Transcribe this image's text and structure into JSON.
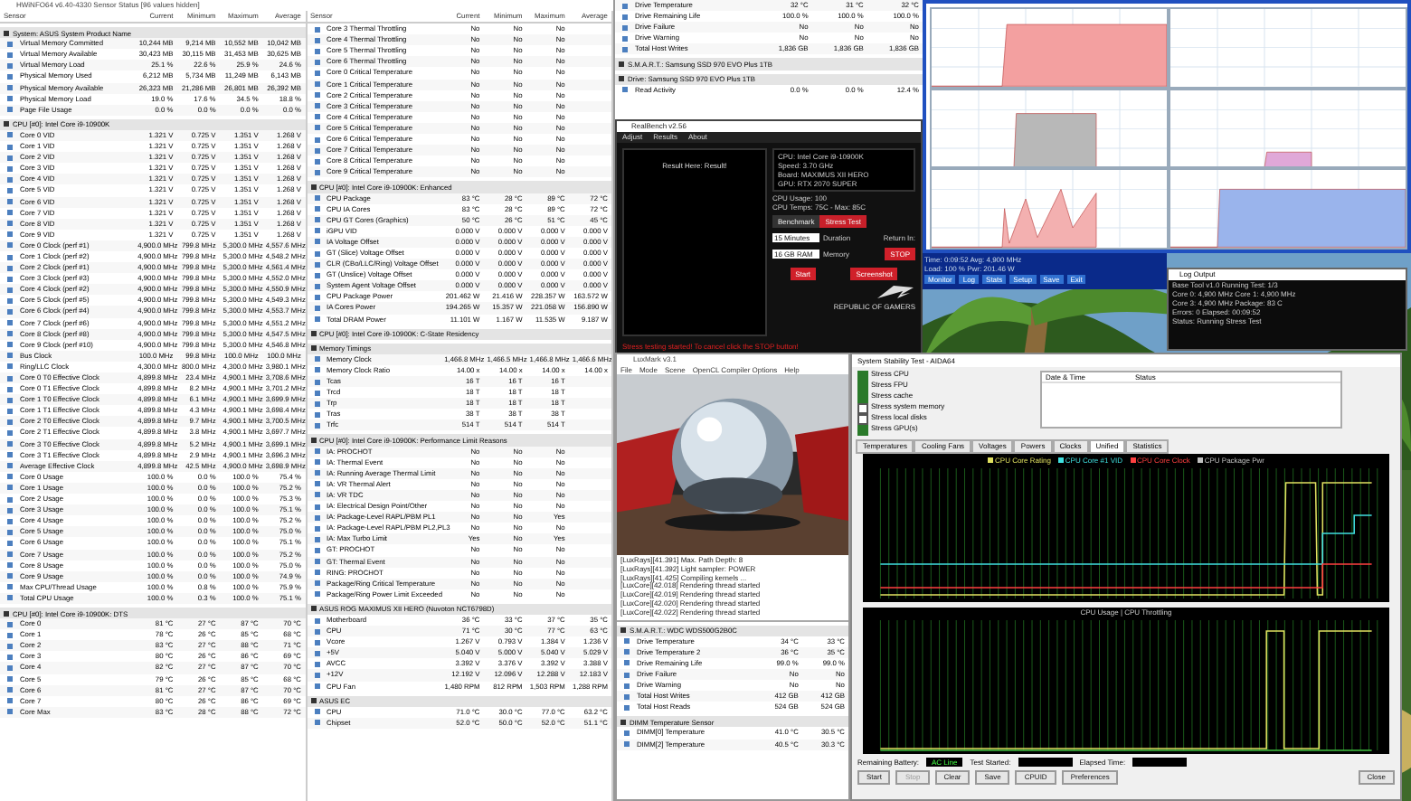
{
  "hwinfo": {
    "title": "HWiNFO64 v6.40-4330 Sensor Status [96 values hidden]",
    "panes": [
      {
        "columns": [
          "Sensor",
          "Current",
          "Minimum",
          "Maximum",
          "Average"
        ],
        "sections": [
          {
            "title": "System: ASUS System Product Name",
            "rows": [
              [
                "Virtual Memory Committed",
                "10,244 MB",
                "9,214 MB",
                "10,552 MB",
                "10,042 MB"
              ],
              [
                "Virtual Memory Available",
                "30,423 MB",
                "30,115 MB",
                "31,453 MB",
                "30,625 MB"
              ],
              [
                "Virtual Memory Load",
                "25.1 %",
                "22.6 %",
                "25.9 %",
                "24.6 %"
              ],
              [
                "Physical Memory Used",
                "6,212 MB",
                "5,734 MB",
                "11,249 MB",
                "6,143 MB"
              ],
              [
                "Physical Memory Available",
                "26,323 MB",
                "21,286 MB",
                "26,801 MB",
                "26,392 MB"
              ],
              [
                "Physical Memory Load",
                "19.0 %",
                "17.6 %",
                "34.5 %",
                "18.8 %"
              ],
              [
                "Page File Usage",
                "0.0 %",
                "0.0 %",
                "0.0 %",
                "0.0 %"
              ]
            ]
          },
          {
            "title": "CPU [#0]: Intel Core i9-10900K",
            "rows": [
              [
                "Core 0 VID",
                "1.321 V",
                "0.725 V",
                "1.351 V",
                "1.268 V"
              ],
              [
                "Core 1 VID",
                "1.321 V",
                "0.725 V",
                "1.351 V",
                "1.268 V"
              ],
              [
                "Core 2 VID",
                "1.321 V",
                "0.725 V",
                "1.351 V",
                "1.268 V"
              ],
              [
                "Core 3 VID",
                "1.321 V",
                "0.725 V",
                "1.351 V",
                "1.268 V"
              ],
              [
                "Core 4 VID",
                "1.321 V",
                "0.725 V",
                "1.351 V",
                "1.268 V"
              ],
              [
                "Core 5 VID",
                "1.321 V",
                "0.725 V",
                "1.351 V",
                "1.268 V"
              ],
              [
                "Core 6 VID",
                "1.321 V",
                "0.725 V",
                "1.351 V",
                "1.268 V"
              ],
              [
                "Core 7 VID",
                "1.321 V",
                "0.725 V",
                "1.351 V",
                "1.268 V"
              ],
              [
                "Core 8 VID",
                "1.321 V",
                "0.725 V",
                "1.351 V",
                "1.268 V"
              ],
              [
                "Core 9 VID",
                "1.321 V",
                "0.725 V",
                "1.351 V",
                "1.268 V"
              ],
              [
                "Core 0 Clock (perf #1)",
                "4,900.0 MHz",
                "799.8 MHz",
                "5,300.0 MHz",
                "4,557.6 MHz"
              ],
              [
                "Core 1 Clock (perf #2)",
                "4,900.0 MHz",
                "799.8 MHz",
                "5,300.0 MHz",
                "4,548.2 MHz"
              ],
              [
                "Core 2 Clock (perf #1)",
                "4,900.0 MHz",
                "799.8 MHz",
                "5,300.0 MHz",
                "4,561.4 MHz"
              ],
              [
                "Core 3 Clock (perf #3)",
                "4,900.0 MHz",
                "799.8 MHz",
                "5,300.0 MHz",
                "4,552.0 MHz"
              ],
              [
                "Core 4 Clock (perf #2)",
                "4,900.0 MHz",
                "799.8 MHz",
                "5,300.0 MHz",
                "4,550.9 MHz"
              ],
              [
                "Core 5 Clock (perf #5)",
                "4,900.0 MHz",
                "799.8 MHz",
                "5,300.0 MHz",
                "4,549.3 MHz"
              ],
              [
                "Core 6 Clock (perf #4)",
                "4,900.0 MHz",
                "799.8 MHz",
                "5,300.0 MHz",
                "4,553.7 MHz"
              ],
              [
                "Core 7 Clock (perf #6)",
                "4,900.0 MHz",
                "799.8 MHz",
                "5,300.0 MHz",
                "4,551.2 MHz"
              ],
              [
                "Core 8 Clock (perf #8)",
                "4,900.0 MHz",
                "799.8 MHz",
                "5,300.0 MHz",
                "4,547.5 MHz"
              ],
              [
                "Core 9 Clock (perf #10)",
                "4,900.0 MHz",
                "799.8 MHz",
                "5,300.0 MHz",
                "4,546.8 MHz"
              ],
              [
                "Bus Clock",
                "100.0 MHz",
                "99.8 MHz",
                "100.0 MHz",
                "100.0 MHz"
              ],
              [
                "Ring/LLC Clock",
                "4,300.0 MHz",
                "800.0 MHz",
                "4,300.0 MHz",
                "3,980.1 MHz"
              ],
              [
                "Core 0 T0 Effective Clock",
                "4,899.8 MHz",
                "23.4 MHz",
                "4,900.1 MHz",
                "3,708.6 MHz"
              ],
              [
                "Core 0 T1 Effective Clock",
                "4,899.8 MHz",
                "8.2 MHz",
                "4,900.1 MHz",
                "3,701.2 MHz"
              ],
              [
                "Core 1 T0 Effective Clock",
                "4,899.8 MHz",
                "6.1 MHz",
                "4,900.1 MHz",
                "3,699.9 MHz"
              ],
              [
                "Core 1 T1 Effective Clock",
                "4,899.8 MHz",
                "4.3 MHz",
                "4,900.1 MHz",
                "3,698.4 MHz"
              ],
              [
                "Core 2 T0 Effective Clock",
                "4,899.8 MHz",
                "9.7 MHz",
                "4,900.1 MHz",
                "3,700.5 MHz"
              ],
              [
                "Core 2 T1 Effective Clock",
                "4,899.8 MHz",
                "3.8 MHz",
                "4,900.1 MHz",
                "3,697.7 MHz"
              ],
              [
                "Core 3 T0 Effective Clock",
                "4,899.8 MHz",
                "5.2 MHz",
                "4,900.1 MHz",
                "3,699.1 MHz"
              ],
              [
                "Core 3 T1 Effective Clock",
                "4,899.8 MHz",
                "2.9 MHz",
                "4,900.1 MHz",
                "3,696.3 MHz"
              ],
              [
                "Average Effective Clock",
                "4,899.8 MHz",
                "42.5 MHz",
                "4,900.0 MHz",
                "3,698.9 MHz"
              ],
              [
                "Core 0 Usage",
                "100.0 %",
                "0.0 %",
                "100.0 %",
                "75.4 %"
              ],
              [
                "Core 1 Usage",
                "100.0 %",
                "0.0 %",
                "100.0 %",
                "75.2 %"
              ],
              [
                "Core 2 Usage",
                "100.0 %",
                "0.0 %",
                "100.0 %",
                "75.3 %"
              ],
              [
                "Core 3 Usage",
                "100.0 %",
                "0.0 %",
                "100.0 %",
                "75.1 %"
              ],
              [
                "Core 4 Usage",
                "100.0 %",
                "0.0 %",
                "100.0 %",
                "75.2 %"
              ],
              [
                "Core 5 Usage",
                "100.0 %",
                "0.0 %",
                "100.0 %",
                "75.0 %"
              ],
              [
                "Core 6 Usage",
                "100.0 %",
                "0.0 %",
                "100.0 %",
                "75.1 %"
              ],
              [
                "Core 7 Usage",
                "100.0 %",
                "0.0 %",
                "100.0 %",
                "75.2 %"
              ],
              [
                "Core 8 Usage",
                "100.0 %",
                "0.0 %",
                "100.0 %",
                "75.0 %"
              ],
              [
                "Core 9 Usage",
                "100.0 %",
                "0.0 %",
                "100.0 %",
                "74.9 %"
              ],
              [
                "Max CPU/Thread Usage",
                "100.0 %",
                "0.8 %",
                "100.0 %",
                "75.9 %"
              ],
              [
                "Total CPU Usage",
                "100.0 %",
                "0.3 %",
                "100.0 %",
                "75.1 %"
              ]
            ]
          },
          {
            "title": "CPU [#0]: Intel Core i9-10900K: DTS",
            "rows": [
              [
                "Core 0",
                "81 °C",
                "27 °C",
                "87 °C",
                "70 °C"
              ],
              [
                "Core 1",
                "78 °C",
                "26 °C",
                "85 °C",
                "68 °C"
              ],
              [
                "Core 2",
                "83 °C",
                "27 °C",
                "88 °C",
                "71 °C"
              ],
              [
                "Core 3",
                "80 °C",
                "26 °C",
                "86 °C",
                "69 °C"
              ],
              [
                "Core 4",
                "82 °C",
                "27 °C",
                "87 °C",
                "70 °C"
              ],
              [
                "Core 5",
                "79 °C",
                "26 °C",
                "85 °C",
                "68 °C"
              ],
              [
                "Core 6",
                "81 °C",
                "27 °C",
                "87 °C",
                "70 °C"
              ],
              [
                "Core 7",
                "80 °C",
                "26 °C",
                "86 °C",
                "69 °C"
              ],
              [
                "Core Max",
                "83 °C",
                "28 °C",
                "88 °C",
                "72 °C"
              ]
            ]
          }
        ]
      },
      {
        "columns": [
          "Sensor",
          "Current",
          "Minimum",
          "Maximum",
          "Average"
        ],
        "sections": [
          {
            "rows": [
              [
                "Core 3 Thermal Throttling",
                "No",
                "No",
                "No",
                ""
              ],
              [
                "Core 4 Thermal Throttling",
                "No",
                "No",
                "No",
                ""
              ],
              [
                "Core 5 Thermal Throttling",
                "No",
                "No",
                "No",
                ""
              ],
              [
                "Core 6 Thermal Throttling",
                "No",
                "No",
                "No",
                ""
              ],
              [
                "Core 0 Critical Temperature",
                "No",
                "No",
                "No",
                ""
              ],
              [
                "Core 1 Critical Temperature",
                "No",
                "No",
                "No",
                ""
              ],
              [
                "Core 2 Critical Temperature",
                "No",
                "No",
                "No",
                ""
              ],
              [
                "Core 3 Critical Temperature",
                "No",
                "No",
                "No",
                ""
              ],
              [
                "Core 4 Critical Temperature",
                "No",
                "No",
                "No",
                ""
              ],
              [
                "Core 5 Critical Temperature",
                "No",
                "No",
                "No",
                ""
              ],
              [
                "Core 6 Critical Temperature",
                "No",
                "No",
                "No",
                ""
              ],
              [
                "Core 7 Critical Temperature",
                "No",
                "No",
                "No",
                ""
              ],
              [
                "Core 8 Critical Temperature",
                "No",
                "No",
                "No",
                ""
              ],
              [
                "Core 9 Critical Temperature",
                "No",
                "No",
                "No",
                ""
              ]
            ]
          },
          {
            "title": "CPU [#0]: Intel Core i9-10900K: Enhanced",
            "rows": [
              [
                "CPU Package",
                "83 °C",
                "28 °C",
                "89 °C",
                "72 °C"
              ],
              [
                "CPU IA Cores",
                "83 °C",
                "28 °C",
                "89 °C",
                "72 °C"
              ],
              [
                "CPU GT Cores (Graphics)",
                "50 °C",
                "26 °C",
                "51 °C",
                "45 °C"
              ],
              [
                "iGPU VID",
                "0.000 V",
                "0.000 V",
                "0.000 V",
                "0.000 V"
              ],
              [
                "IA Voltage Offset",
                "0.000 V",
                "0.000 V",
                "0.000 V",
                "0.000 V"
              ],
              [
                "GT (Slice) Voltage Offset",
                "0.000 V",
                "0.000 V",
                "0.000 V",
                "0.000 V"
              ],
              [
                "CLR (CBo/LLC/Ring) Voltage Offset",
                "0.000 V",
                "0.000 V",
                "0.000 V",
                "0.000 V"
              ],
              [
                "GT (Unslice) Voltage Offset",
                "0.000 V",
                "0.000 V",
                "0.000 V",
                "0.000 V"
              ],
              [
                "System Agent Voltage Offset",
                "0.000 V",
                "0.000 V",
                "0.000 V",
                "0.000 V"
              ],
              [
                "CPU Package Power",
                "201.462 W",
                "21.416 W",
                "228.357 W",
                "163.572 W"
              ],
              [
                "IA Cores Power",
                "194.265 W",
                "15.357 W",
                "221.058 W",
                "156.890 W"
              ],
              [
                "Total DRAM Power",
                "11.101 W",
                "1.167 W",
                "11.535 W",
                "9.187 W"
              ]
            ]
          },
          {
            "title": "CPU [#0]: Intel Core i9-10900K: C-State Residency"
          },
          {
            "title": "Memory Timings",
            "rows": [
              [
                "Memory Clock",
                "1,466.8 MHz",
                "1,466.5 MHz",
                "1,466.8 MHz",
                "1,466.6 MHz"
              ],
              [
                "Memory Clock Ratio",
                "14.00 x",
                "14.00 x",
                "14.00 x",
                "14.00 x"
              ],
              [
                "Tcas",
                "16 T",
                "16 T",
                "16 T",
                ""
              ],
              [
                "Trcd",
                "18 T",
                "18 T",
                "18 T",
                ""
              ],
              [
                "Trp",
                "18 T",
                "18 T",
                "18 T",
                ""
              ],
              [
                "Tras",
                "38 T",
                "38 T",
                "38 T",
                ""
              ],
              [
                "Trfc",
                "514 T",
                "514 T",
                "514 T",
                ""
              ]
            ]
          },
          {
            "title": "CPU [#0]: Intel Core i9-10900K: Performance Limit Reasons",
            "rows": [
              [
                "IA: PROCHOT",
                "No",
                "No",
                "No",
                ""
              ],
              [
                "IA: Thermal Event",
                "No",
                "No",
                "No",
                ""
              ],
              [
                "IA: Running Average Thermal Limit",
                "No",
                "No",
                "No",
                ""
              ],
              [
                "IA: VR Thermal Alert",
                "No",
                "No",
                "No",
                ""
              ],
              [
                "IA: VR TDC",
                "No",
                "No",
                "No",
                ""
              ],
              [
                "IA: Electrical Design Point/Other",
                "No",
                "No",
                "No",
                ""
              ],
              [
                "IA: Package-Level RAPL/PBM PL1",
                "No",
                "No",
                "Yes",
                ""
              ],
              [
                "IA: Package-Level RAPL/PBM PL2,PL3",
                "No",
                "No",
                "No",
                ""
              ],
              [
                "IA: Max Turbo Limit",
                "Yes",
                "No",
                "Yes",
                ""
              ],
              [
                "GT: PROCHOT",
                "No",
                "No",
                "No",
                ""
              ],
              [
                "GT: Thermal Event",
                "No",
                "No",
                "No",
                ""
              ],
              [
                "RING: PROCHOT",
                "No",
                "No",
                "No",
                ""
              ],
              [
                "Package/Ring Critical Temperature",
                "No",
                "No",
                "No",
                ""
              ],
              [
                "Package/Ring Power Limit Exceeded",
                "No",
                "No",
                "No",
                ""
              ]
            ]
          },
          {
            "title": "ASUS ROG MAXIMUS XII HERO (Nuvoton NCT6798D)",
            "rows": [
              [
                "Motherboard",
                "36 °C",
                "33 °C",
                "37 °C",
                "35 °C"
              ],
              [
                "CPU",
                "71 °C",
                "30 °C",
                "77 °C",
                "63 °C"
              ],
              [
                "Vcore",
                "1.267 V",
                "0.793 V",
                "1.384 V",
                "1.236 V"
              ],
              [
                "+5V",
                "5.040 V",
                "5.000 V",
                "5.040 V",
                "5.029 V"
              ],
              [
                "AVCC",
                "3.392 V",
                "3.376 V",
                "3.392 V",
                "3.388 V"
              ],
              [
                "+12V",
                "12.192 V",
                "12.096 V",
                "12.288 V",
                "12.183 V"
              ],
              [
                "CPU Fan",
                "1,480 RPM",
                "812 RPM",
                "1,503 RPM",
                "1,288 RPM"
              ]
            ]
          },
          {
            "title": "ASUS EC",
            "rows": [
              [
                "CPU",
                "71.0 °C",
                "30.0 °C",
                "77.0 °C",
                "63.2 °C"
              ],
              [
                "Chipset",
                "52.0 °C",
                "50.0 °C",
                "52.0 °C",
                "51.1 °C"
              ]
            ]
          }
        ]
      }
    ]
  },
  "hwinfo_top": {
    "rows": [
      [
        "Drive Temperature",
        "32 °C",
        "31 °C",
        "32 °C"
      ],
      [
        "Drive Remaining Life",
        "100.0 %",
        "100.0 %",
        "100.0 %"
      ],
      [
        "Drive Failure",
        "No",
        "No",
        "No"
      ],
      [
        "Drive Warning",
        "No",
        "No",
        "No"
      ],
      [
        "Total Host Writes",
        "1,836 GB",
        "1,836 GB",
        "1,836 GB"
      ]
    ],
    "section": "S.M.A.R.T.: Samsung SSD 970 EVO Plus 1TB",
    "section2": "Drive: Samsung SSD 970 EVO Plus 1TB",
    "rows2": [
      [
        "Read Activity",
        "0.0 %",
        "0.0 %",
        "12.4 %"
      ]
    ]
  },
  "realbench": {
    "title": "RealBench v2.56",
    "menu": [
      "Adjust",
      "Results",
      "About"
    ],
    "result": "Result Here: Result!",
    "info": [
      "CPU: Intel Core i9-10900K",
      "Speed: 3.70 GHz",
      "Board: MAXIMUS XII HERO",
      "GPU: RTX 2070 SUPER"
    ],
    "cpu_usage": "CPU Usage: 100",
    "cpu_temp": "CPU Temps: 75C - Max: 85C",
    "tabs": [
      {
        "label": "Benchmark",
        "selected": false
      },
      {
        "label": "Stress Test",
        "selected": true
      }
    ],
    "duration": "15 Minutes",
    "duration_label": "Duration",
    "memory": "16 GB RAM",
    "memory_label": "Memory",
    "return_label": "Return In:",
    "stop": "STOP",
    "start": "Start",
    "screenshot": "Screenshot",
    "logo_text": "REPUBLIC OF GAMERS",
    "warning": "Stress testing started! To cancel click the STOP button!"
  },
  "viewer": {
    "title": "LuxMark v3.1",
    "menu": [
      "File",
      "Mode",
      "Scene",
      "OpenCL Compiler Options",
      "Help"
    ],
    "log": [
      "[LuxRays][41.391] Max. Path Depth: 8",
      "[LuxRays][41.392] Light sampler: POWER",
      "[LuxRays][41.425] Compiling kernels ...",
      "[LuxCore][42.018] Rendering thread started",
      "[LuxCore][42.019] Rendering thread started",
      "[LuxCore][42.020] Rendering thread started",
      "[LuxCore][42.022] Rendering thread started"
    ],
    "hw_rows": [
      [
        "Drive Temperature",
        "34 °C",
        "33 °C"
      ],
      [
        "Drive Temperature 2",
        "36 °C",
        "35 °C"
      ],
      [
        "Drive Remaining Life",
        "99.0 %",
        "99.0 %"
      ],
      [
        "Drive Failure",
        "No",
        "No"
      ],
      [
        "Drive Warning",
        "No",
        "No"
      ],
      [
        "Total Host Writes",
        "412 GB",
        "412 GB"
      ],
      [
        "Total Host Reads",
        "524 GB",
        "524 GB"
      ]
    ],
    "hw_section": "S.M.A.R.T.: WDC WDS500G2B0C",
    "hw_section2": "DIMM Temperature Sensor",
    "hw_rows2": [
      [
        "DIMM[0] Temperature",
        "41.0 °C",
        "30.5 °C"
      ],
      [
        "DIMM[2] Temperature",
        "40.5 °C",
        "30.3 °C"
      ]
    ]
  },
  "log_window": {
    "title": "Log Output",
    "lines": [
      "Base Tool v1.0 Running Test: 1/3",
      "Core 0: 4,900 MHz  Core 1: 4,900 MHz",
      "Core 3: 4,900 MHz  Package: 83 C",
      "Errors: 0  Elapsed: 00:09:52",
      "Status: Running Stress Test"
    ]
  },
  "cpuz": {
    "lines": [
      "Time: 0:09:52  Avg: 4,900 MHz",
      "Load: 100 %  Pwr: 201.46 W"
    ],
    "buttons": [
      "Monitor",
      "Log",
      "Stats",
      "Setup",
      "Save",
      "Exit"
    ]
  },
  "aida": {
    "title": "System Stability Test - AIDA64",
    "options": [
      {
        "label": "Stress CPU",
        "checked": true
      },
      {
        "label": "Stress FPU",
        "checked": true
      },
      {
        "label": "Stress cache",
        "checked": true
      },
      {
        "label": "Stress system memory",
        "checked": false
      },
      {
        "label": "Stress local disks",
        "checked": false
      },
      {
        "label": "Stress GPU(s)",
        "checked": true
      }
    ],
    "log_columns": [
      "Date & Time",
      "Status"
    ],
    "tabs": [
      {
        "label": "Temperatures",
        "selected": false
      },
      {
        "label": "Cooling Fans",
        "selected": false
      },
      {
        "label": "Voltages",
        "selected": false
      },
      {
        "label": "Powers",
        "selected": false
      },
      {
        "label": "Clocks",
        "selected": false
      },
      {
        "label": "Unified",
        "selected": true
      },
      {
        "label": "Statistics",
        "selected": false
      }
    ],
    "legend": [
      {
        "label": "CPU Core Rating",
        "color": "#e0e060"
      },
      {
        "label": "CPU Core #1 VID",
        "color": "#40e0e0"
      },
      {
        "label": "CPU Core Clock",
        "color": "#ff4040"
      },
      {
        "label": "CPU Package Pwr",
        "color": "#c0c0c0"
      }
    ],
    "chart2_title": "CPU Usage | CPU Throttling",
    "battery_label": "Remaining Battery:",
    "battery": "AC Line",
    "started_label": "Test Started:",
    "elapsed_label": "Elapsed Time:",
    "buttons": [
      {
        "label": "Start",
        "disabled": false
      },
      {
        "label": "Stop",
        "disabled": true
      },
      {
        "label": "Clear",
        "disabled": false
      },
      {
        "label": "Save",
        "disabled": false
      },
      {
        "label": "CPUID",
        "disabled": false
      },
      {
        "label": "Preferences",
        "disabled": false
      }
    ],
    "close": "Close"
  }
}
